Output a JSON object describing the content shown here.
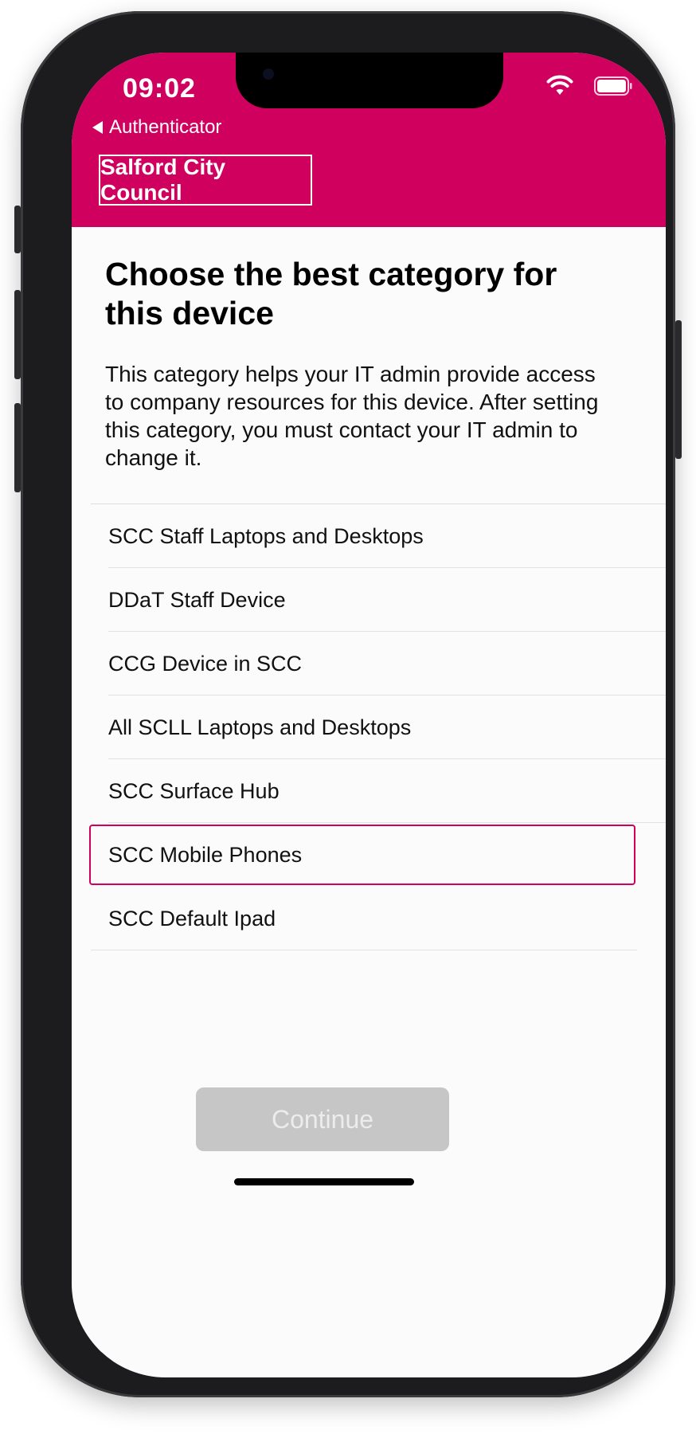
{
  "status_bar": {
    "time": "09:02",
    "back_label": "Authenticator"
  },
  "header": {
    "brand": "Salford City Council",
    "brand_color": "#d0005e"
  },
  "content": {
    "title": "Choose the best category for this device",
    "description": "This category helps your IT admin provide access to company resources for this device. After setting this category, you must contact your IT admin to change it."
  },
  "categories": [
    {
      "label": "SCC Staff Laptops and Desktops"
    },
    {
      "label": "DDaT Staff Device"
    },
    {
      "label": "CCG Device in SCC"
    },
    {
      "label": "All SCLL Laptops and Desktops"
    },
    {
      "label": "SCC Surface Hub"
    },
    {
      "label": "SCC Mobile Phones",
      "selected": true
    },
    {
      "label": "SCC Default Ipad"
    }
  ],
  "footer": {
    "continue_label": "Continue",
    "continue_enabled": false
  },
  "icons": [
    "back-arrow-icon",
    "wifi-icon",
    "battery-icon"
  ]
}
